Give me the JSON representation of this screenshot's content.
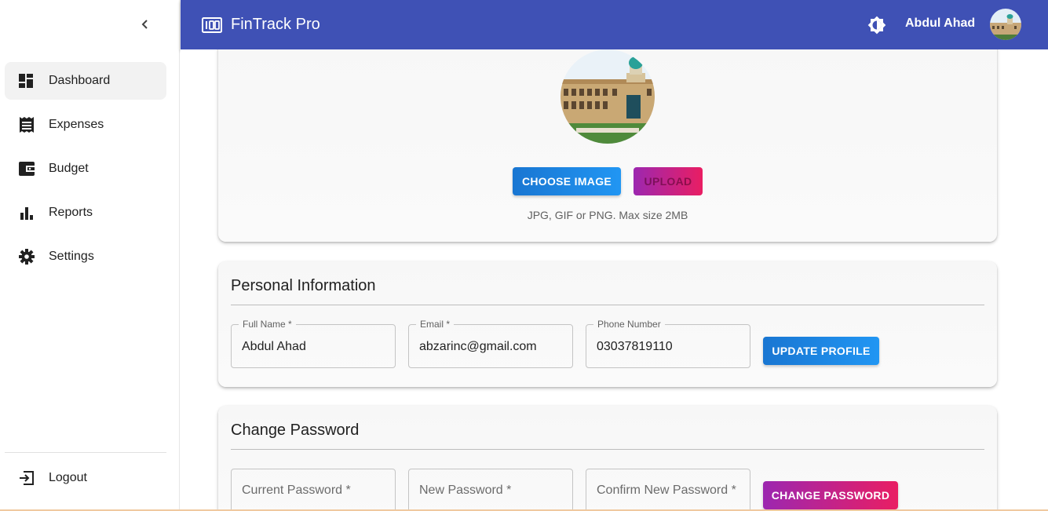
{
  "app": {
    "title": "FinTrack Pro",
    "user_name": "Abdul Ahad"
  },
  "sidebar": {
    "items": [
      {
        "label": "Dashboard",
        "icon": "dashboard-icon",
        "active": true
      },
      {
        "label": "Expenses",
        "icon": "receipt-icon"
      },
      {
        "label": "Budget",
        "icon": "wallet-icon"
      },
      {
        "label": "Reports",
        "icon": "bar-chart-icon"
      },
      {
        "label": "Settings",
        "icon": "gear-icon"
      }
    ],
    "logout_label": "Logout"
  },
  "avatar_card": {
    "choose_label": "CHOOSE IMAGE",
    "upload_label": "UPLOAD",
    "hint": "JPG, GIF or PNG. Max size 2MB"
  },
  "personal": {
    "title": "Personal Information",
    "full_name_label": "Full Name *",
    "full_name_value": "Abdul Ahad",
    "email_label": "Email *",
    "email_value": "abzarinc@gmail.com",
    "phone_label": "Phone Number",
    "phone_value": "03037819110",
    "update_label": "UPDATE PROFILE"
  },
  "password": {
    "title": "Change Password",
    "current_placeholder": "Current Password *",
    "new_placeholder": "New Password *",
    "confirm_placeholder": "Confirm New Password *",
    "change_label": "CHANGE PASSWORD"
  },
  "colors": {
    "header": "#3f51b5",
    "primary": "#1976d2",
    "secondary": "#e91e63"
  }
}
